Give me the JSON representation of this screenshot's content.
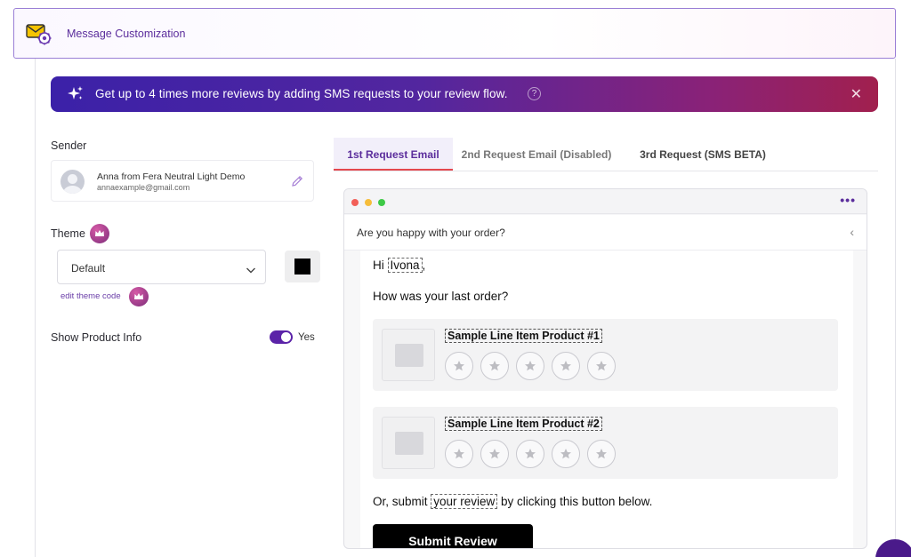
{
  "header": {
    "title": "Message Customization",
    "icon": "envelope-gear-icon"
  },
  "promo": {
    "text": "Get up to 4 times more reviews by adding SMS requests to your review flow.",
    "help_icon": "?",
    "close_icon": "✕"
  },
  "sender": {
    "label": "Sender",
    "name": "Anna from Fera Neutral Light Demo",
    "email": "annaexample@gmail.com"
  },
  "theme": {
    "label": "Theme",
    "selected": "Default",
    "swatch_color": "#000000",
    "edit_link": "edit theme code"
  },
  "product_info": {
    "label": "Show Product Info",
    "enabled": true,
    "value_label": "Yes"
  },
  "tabs": [
    {
      "label": "1st Request Email",
      "active": true
    },
    {
      "label": "2nd Request Email (Disabled)",
      "active": false
    },
    {
      "label": "3rd Request (SMS BETA)",
      "active": false
    }
  ],
  "preview": {
    "more_icon": "•••",
    "subject": "Are you happy with your order?",
    "back_icon": "‹",
    "greeting_prefix": "Hi ",
    "customer_name": "Ivona",
    "greeting_suffix": ",",
    "question": "How was your last order?",
    "products": [
      {
        "name": "Sample Line Item Product #1",
        "stars": 5
      },
      {
        "name": "Sample Line Item Product #2",
        "stars": 5
      }
    ],
    "cta_prefix": "Or, submit ",
    "cta_link": "your review",
    "cta_suffix": " by clicking this button below.",
    "submit_label": "Submit Review"
  },
  "colors": {
    "accent": "#5b2d9c",
    "tab_underline": "#e4474e",
    "promo_start": "#3b21a8",
    "promo_end": "#a1204e",
    "toggle": "#5b23a8"
  }
}
